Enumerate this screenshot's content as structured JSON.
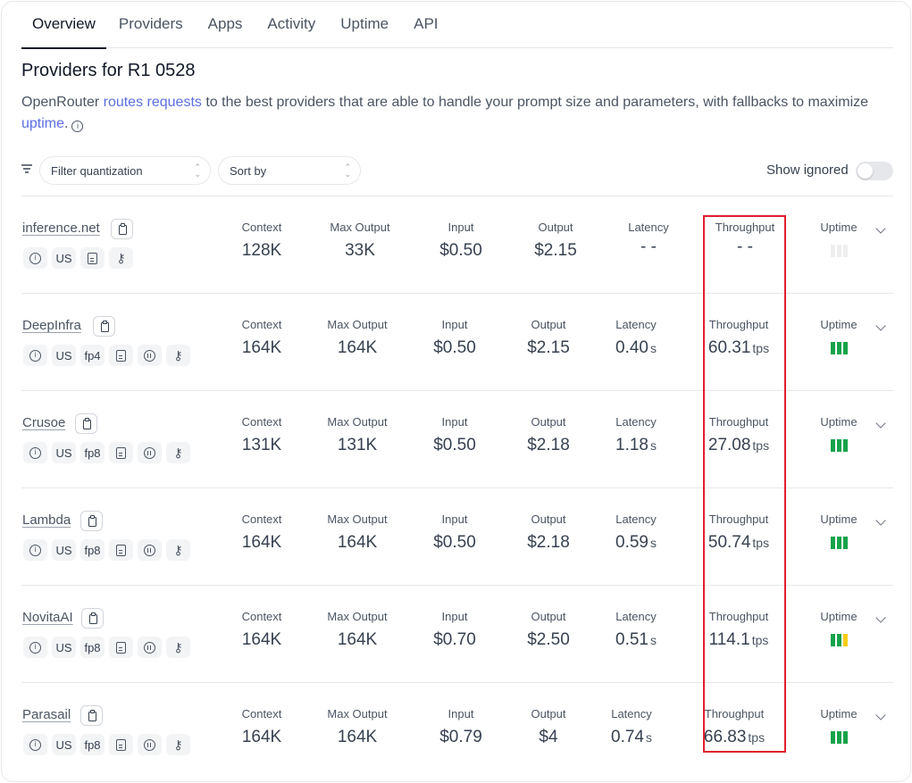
{
  "tabs": [
    {
      "label": "Overview",
      "active": true
    },
    {
      "label": "Providers"
    },
    {
      "label": "Apps"
    },
    {
      "label": "Activity"
    },
    {
      "label": "Uptime"
    },
    {
      "label": "API"
    }
  ],
  "title": "Providers for R1 0528",
  "description": {
    "pre": "OpenRouter ",
    "link1": "routes requests",
    "mid": " to the best providers that are able to handle your prompt size and parameters, with fallbacks to maximize ",
    "link2": "uptime",
    "post": "."
  },
  "filters": {
    "quantization_placeholder": "Filter quantization",
    "sort_placeholder": "Sort by",
    "show_ignored_label": "Show ignored",
    "show_ignored_on": false
  },
  "columns": {
    "context": "Context",
    "max_output": "Max Output",
    "input": "Input",
    "output": "Output",
    "latency": "Latency",
    "throughput": "Throughput",
    "uptime": "Uptime"
  },
  "units": {
    "latency": "s",
    "throughput": "tps"
  },
  "colors": {
    "uptime_good": "#16a34a",
    "uptime_warn": "#facc15",
    "uptime_none": "#eeeeee",
    "highlight": "#e11d2e",
    "link": "#5b6ee1"
  },
  "providers": [
    {
      "name": "inference.net",
      "chips": [
        "info-icon",
        "US",
        "doc-icon",
        "key-icon"
      ],
      "context": "128K",
      "max_output": "33K",
      "input": "$0.50",
      "output": "$2.15",
      "latency": "- -",
      "throughput": "- -",
      "uptime": [
        "none",
        "none",
        "none"
      ]
    },
    {
      "name": "DeepInfra",
      "chips": [
        "info-icon",
        "US",
        "fp4",
        "doc-icon",
        "pause-icon",
        "key-icon"
      ],
      "context": "164K",
      "max_output": "164K",
      "input": "$0.50",
      "output": "$2.15",
      "latency": "0.40",
      "throughput": "60.31",
      "uptime": [
        "good",
        "good",
        "good"
      ]
    },
    {
      "name": "Crusoe",
      "chips": [
        "info-icon",
        "US",
        "fp8",
        "doc-icon",
        "pause-icon",
        "key-icon"
      ],
      "context": "131K",
      "max_output": "131K",
      "input": "$0.50",
      "output": "$2.18",
      "latency": "1.18",
      "throughput": "27.08",
      "uptime": [
        "good",
        "good",
        "good"
      ]
    },
    {
      "name": "Lambda",
      "chips": [
        "info-icon",
        "US",
        "fp8",
        "doc-icon",
        "pause-icon",
        "key-icon"
      ],
      "context": "164K",
      "max_output": "164K",
      "input": "$0.50",
      "output": "$2.18",
      "latency": "0.59",
      "throughput": "50.74",
      "uptime": [
        "good",
        "good",
        "good"
      ]
    },
    {
      "name": "NovitaAI",
      "chips": [
        "info-icon",
        "US",
        "fp8",
        "doc-icon",
        "pause-icon",
        "key-icon"
      ],
      "context": "164K",
      "max_output": "164K",
      "input": "$0.70",
      "output": "$2.50",
      "latency": "0.51",
      "throughput": "114.1",
      "uptime": [
        "good",
        "good",
        "warn"
      ]
    },
    {
      "name": "Parasail",
      "chips": [
        "info-icon",
        "US",
        "fp8",
        "doc-icon",
        "pause-icon",
        "key-icon"
      ],
      "context": "164K",
      "max_output": "164K",
      "input": "$0.79",
      "output": "$4",
      "latency": "0.74",
      "throughput": "66.83",
      "uptime": [
        "good",
        "good",
        "good"
      ]
    }
  ]
}
